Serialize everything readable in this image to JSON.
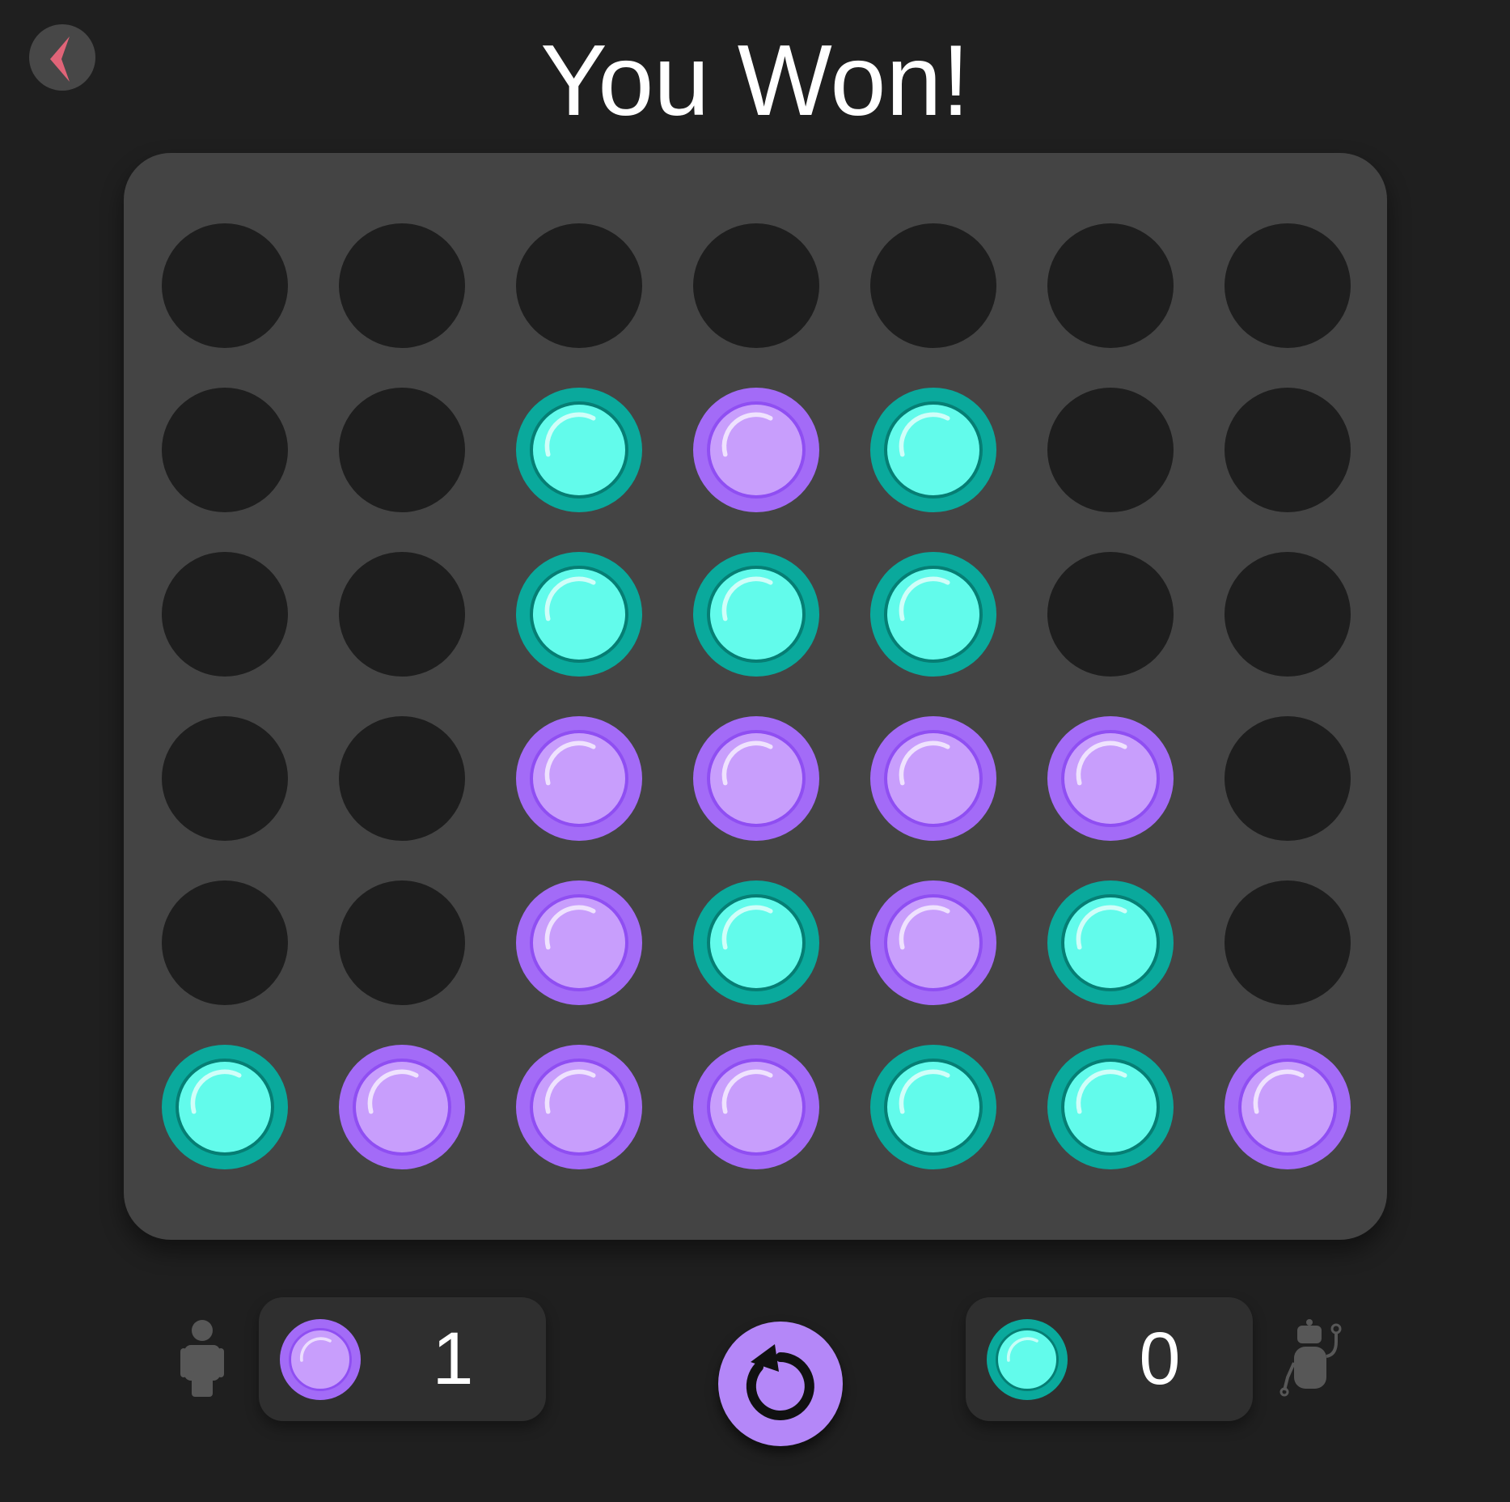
{
  "header": {
    "title": "You Won!",
    "back_icon": "chevron-left-icon"
  },
  "colors": {
    "background": "#1f1f1f",
    "board": "#444444",
    "empty_hole": "#1e1e1e",
    "player_disc": "#c89efc",
    "player_ring": "#a36bf7",
    "ai_disc": "#62fbeb",
    "ai_ring": "#0aa99c",
    "back_arrow": "#e06478"
  },
  "board": {
    "columns": 7,
    "rows": 6,
    "grid": [
      [
        "empty",
        "empty",
        "empty",
        "empty",
        "empty",
        "empty",
        "empty"
      ],
      [
        "empty",
        "empty",
        "teal",
        "purple",
        "teal",
        "empty",
        "empty"
      ],
      [
        "empty",
        "empty",
        "teal",
        "teal",
        "teal",
        "empty",
        "empty"
      ],
      [
        "empty",
        "empty",
        "purple",
        "purple",
        "purple",
        "purple",
        "empty"
      ],
      [
        "empty",
        "empty",
        "purple",
        "teal",
        "purple",
        "teal",
        "empty"
      ],
      [
        "teal",
        "purple",
        "purple",
        "purple",
        "teal",
        "teal",
        "purple"
      ]
    ]
  },
  "scores": {
    "player": {
      "icon": "person-icon",
      "disc_color": "purple",
      "value": "1"
    },
    "ai": {
      "icon": "robot-icon",
      "disc_color": "teal",
      "value": "0"
    }
  },
  "controls": {
    "restart_icon": "restart-icon"
  }
}
